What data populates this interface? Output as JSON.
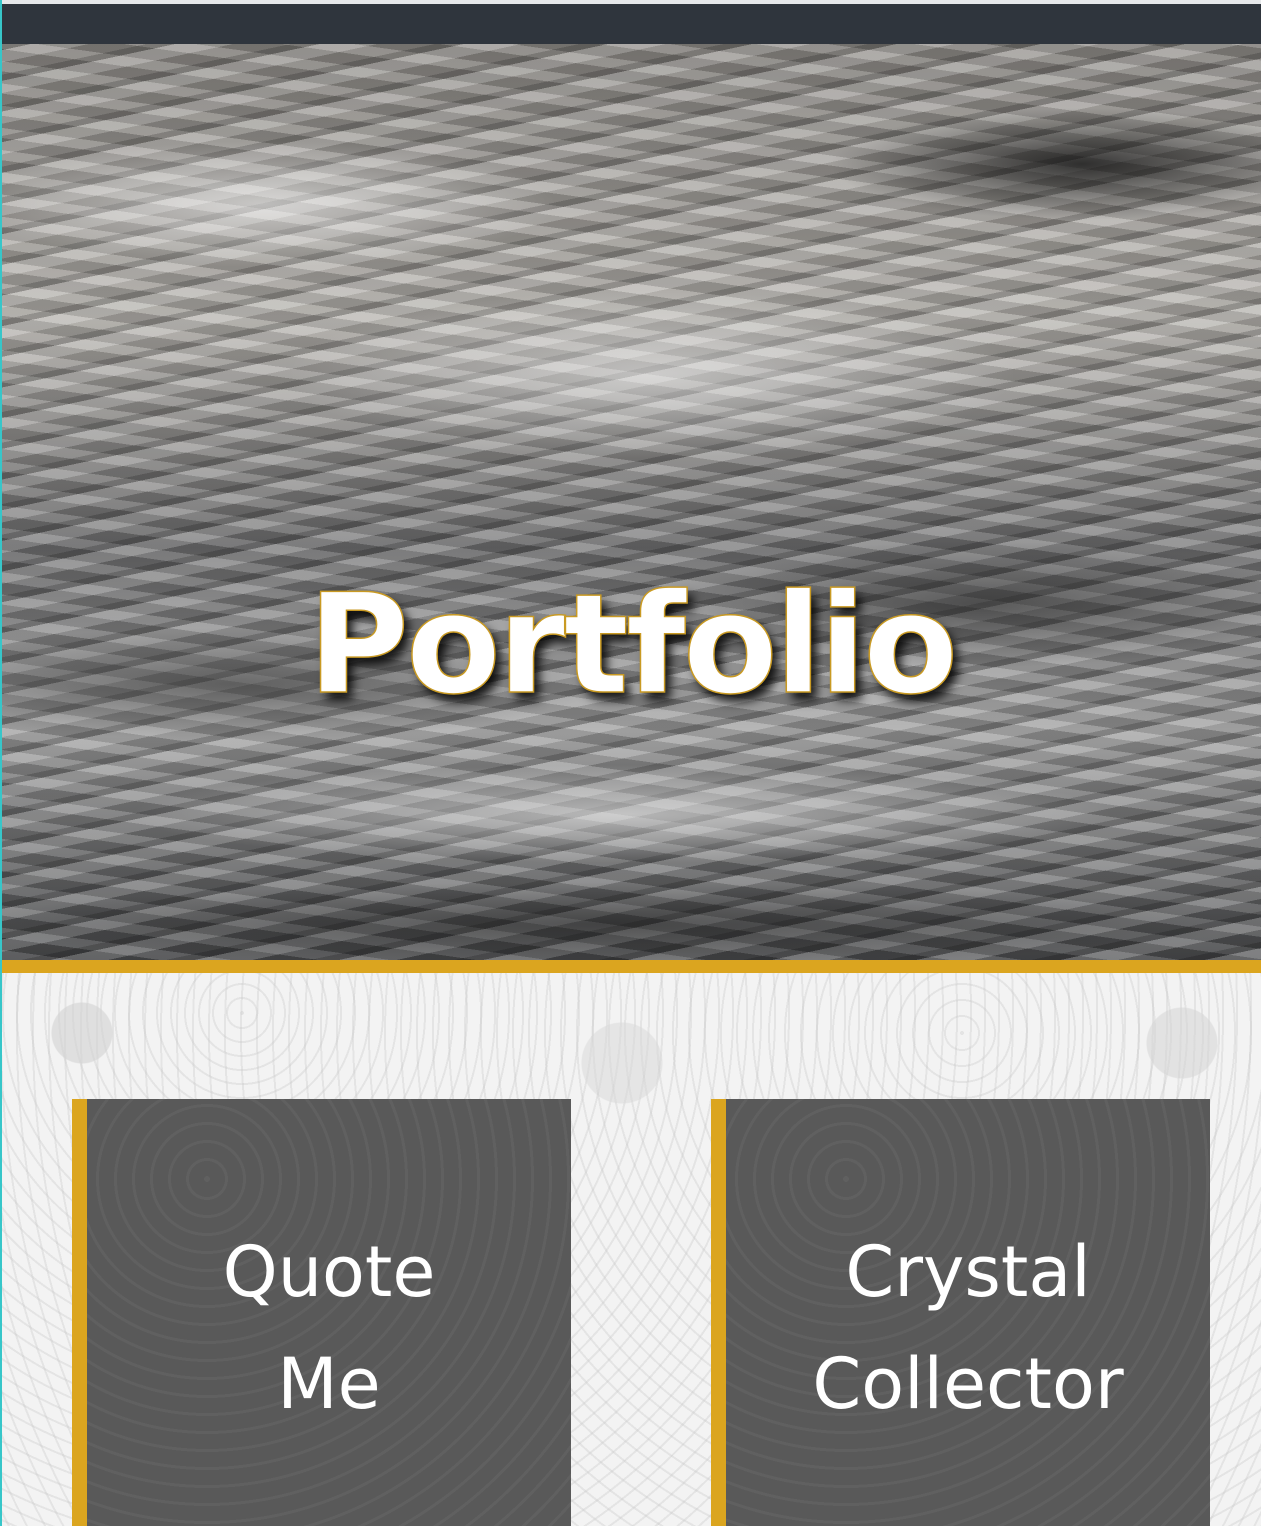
{
  "hero": {
    "title": "Portfolio"
  },
  "cards": [
    {
      "lines": [
        "Quote",
        "Me"
      ]
    },
    {
      "lines": [
        "Crystal",
        "Collector"
      ]
    }
  ],
  "colors": {
    "topbar": "#2f353d",
    "accent_gold": "#dba51f",
    "card_bg": "#595959",
    "left_edge": "#37c6c9"
  }
}
